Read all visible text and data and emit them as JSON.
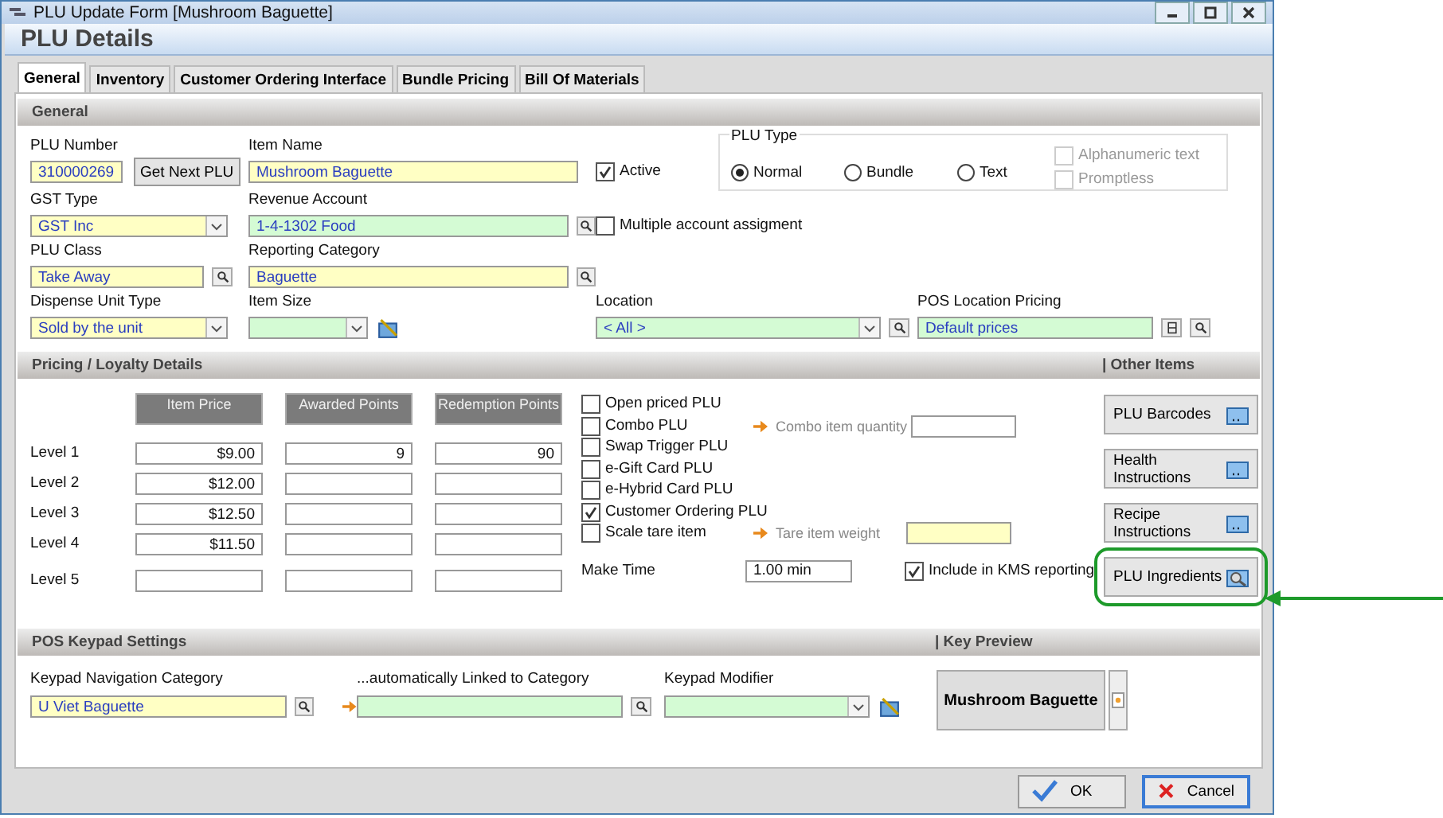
{
  "window": {
    "title": "PLU Update Form [Mushroom Baguette]",
    "header": "PLU Details"
  },
  "tabs": [
    {
      "label": "General",
      "selected": true
    },
    {
      "label": "Inventory",
      "selected": false
    },
    {
      "label": "Customer Ordering Interface",
      "selected": false
    },
    {
      "label": "Bundle Pricing",
      "selected": false
    },
    {
      "label": "Bill Of Materials",
      "selected": false
    }
  ],
  "general": {
    "section_title": "General",
    "plu_number": {
      "label": "PLU Number",
      "value": "310000269",
      "kind": "required"
    },
    "get_next_button": "Get Next PLU",
    "item_name": {
      "label": "Item Name",
      "value": "Mushroom Baguette",
      "kind": "required"
    },
    "active": {
      "label": "Active",
      "checked": true
    },
    "plu_type": {
      "label": "PLU Type",
      "options": [
        {
          "label": "Normal",
          "selected": true
        },
        {
          "label": "Bundle",
          "selected": false
        },
        {
          "label": "Text",
          "selected": false
        }
      ],
      "flags": [
        {
          "label": "Alphanumeric text",
          "checked": false,
          "disabled": true
        },
        {
          "label": "Promptless",
          "checked": false,
          "disabled": true
        }
      ]
    },
    "gst_type": {
      "label": "GST Type",
      "value": "GST Inc",
      "kind": "required"
    },
    "revenue_account": {
      "label": "Revenue Account",
      "value": "1-4-1302  Food",
      "kind": "lookup"
    },
    "multiple_account": {
      "label": "Multiple account assigment",
      "checked": false
    },
    "plu_class": {
      "label": "PLU Class",
      "value": "Take Away",
      "kind": "required"
    },
    "reporting_category": {
      "label": "Reporting Category",
      "value": "Baguette",
      "kind": "required"
    },
    "dispense_unit_type": {
      "label": "Dispense Unit Type",
      "value": "Sold by the unit",
      "kind": "required"
    },
    "item_size": {
      "label": "Item Size",
      "kind": "lookup"
    },
    "location": {
      "label": "Location",
      "value": "< All >",
      "kind": "lookup"
    },
    "pos_location_pricing": {
      "label": "POS Location Pricing",
      "value": "Default prices",
      "kind": "lookup"
    }
  },
  "pricing": {
    "section_title": "Pricing / Loyalty Details",
    "side_title": "| Other Items",
    "columns": [
      "Item Price",
      "Awarded Points",
      "Redemption Points"
    ],
    "levels": [
      {
        "label": "Level 1",
        "item_price": "$9.00",
        "awarded_points": "9",
        "redemption_points": "90"
      },
      {
        "label": "Level 2",
        "item_price": "$12.00"
      },
      {
        "label": "Level 3",
        "item_price": "$12.50"
      },
      {
        "label": "Level 4",
        "item_price": "$11.50"
      },
      {
        "label": "Level 5"
      }
    ],
    "options": [
      {
        "label": "Open priced PLU",
        "checked": false
      },
      {
        "label": "Combo PLU",
        "checked": false,
        "extra": {
          "label": "Combo item quantity",
          "kind": "plain"
        }
      },
      {
        "label": "Swap Trigger PLU",
        "checked": false
      },
      {
        "label": "e-Gift Card PLU",
        "checked": false
      },
      {
        "label": "e-Hybrid Card PLU",
        "checked": false
      },
      {
        "label": "Customer Ordering PLU",
        "checked": true
      },
      {
        "label": "Scale tare item",
        "checked": false,
        "extra": {
          "label": "Tare item weight",
          "kind": "required"
        }
      }
    ],
    "make_time": {
      "label": "Make Time",
      "value": "1.00 min"
    },
    "kms": {
      "label": "Include in KMS reporting",
      "checked": true
    },
    "other_items": [
      {
        "label": "PLU Barcodes",
        "kind": "list"
      },
      {
        "label": "Health Instructions",
        "kind": "list"
      },
      {
        "label": "Recipe Instructions",
        "kind": "list"
      },
      {
        "label": "PLU Ingredients",
        "kind": "search"
      }
    ]
  },
  "keypad": {
    "section_title": "POS Keypad Settings",
    "side_title": "| Key Preview",
    "navigation": {
      "label": "Keypad Navigation Category",
      "value": "U Viet Baguette",
      "kind": "required"
    },
    "linked": {
      "label": "...automatically Linked to Category",
      "kind": "lookup"
    },
    "modifier": {
      "label": "Keypad Modifier",
      "kind": "lookup"
    },
    "key_preview": "Mushroom Baguette"
  },
  "buttons": [
    {
      "label": "OK",
      "kind": "ok"
    },
    {
      "label": "Cancel",
      "kind": "cancel"
    }
  ]
}
